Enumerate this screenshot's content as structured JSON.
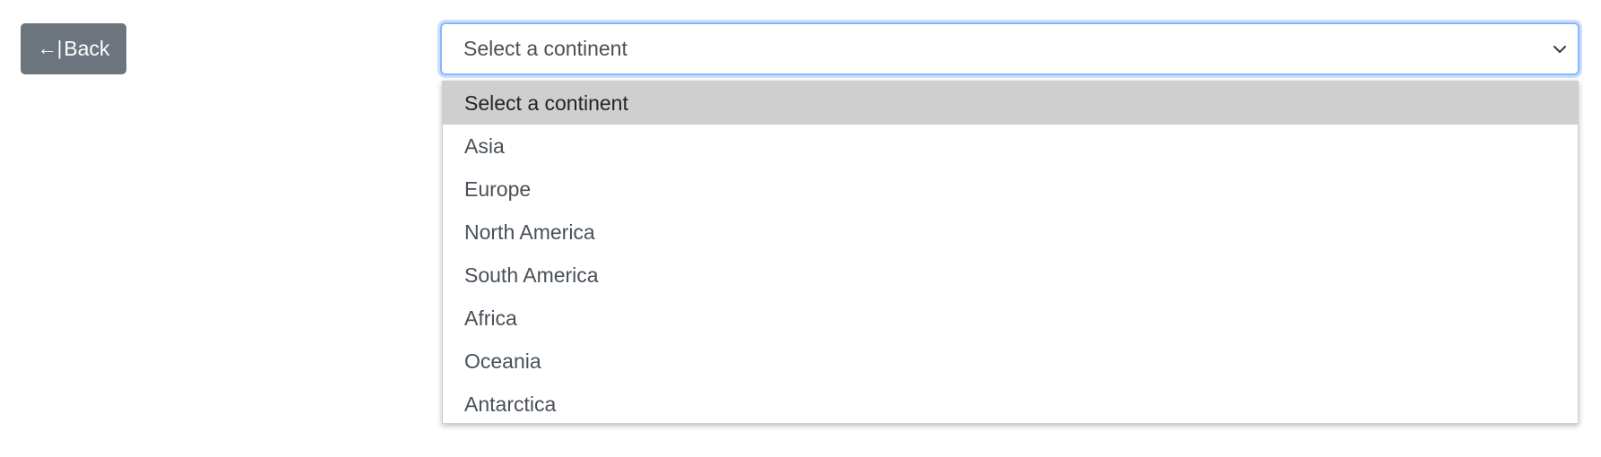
{
  "back_button": {
    "icon": "arrow-left-to-bar-icon",
    "icon_glyph": "←|",
    "label": "Back"
  },
  "continent_select": {
    "selected_value": "Select a continent",
    "chevron_icon": "chevron-down-icon",
    "is_open": true,
    "options": [
      {
        "label": "Select a continent",
        "highlighted": true
      },
      {
        "label": "Asia"
      },
      {
        "label": "Europe"
      },
      {
        "label": "North America"
      },
      {
        "label": "South America"
      },
      {
        "label": "Africa"
      },
      {
        "label": "Oceania"
      },
      {
        "label": "Antarctica"
      }
    ]
  },
  "colors": {
    "button_bg": "#6c757d",
    "focus_border": "#86b7fe",
    "highlight_bg": "#cfcfcf",
    "text": "#495057"
  }
}
